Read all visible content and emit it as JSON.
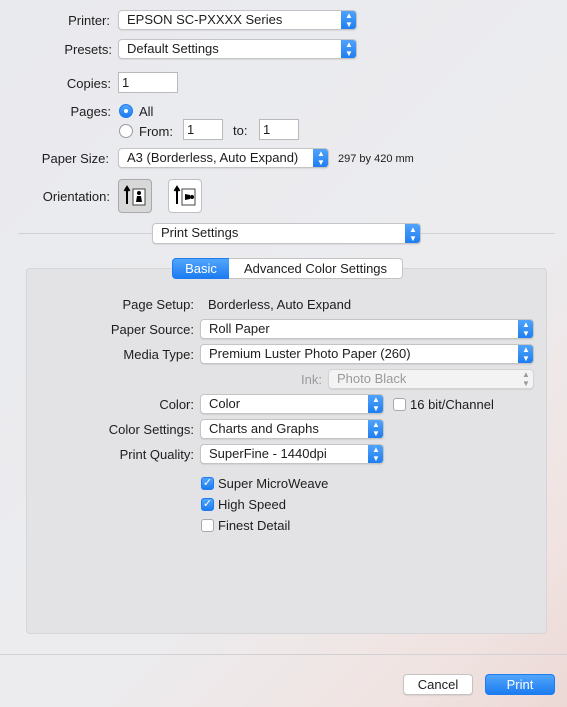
{
  "printer": {
    "label": "Printer:",
    "value": "EPSON SC-PXXXX Series"
  },
  "presets": {
    "label": "Presets:",
    "value": "Default Settings"
  },
  "copies": {
    "label": "Copies:",
    "value": "1"
  },
  "pages": {
    "label": "Pages:",
    "all_label": "All",
    "from_label": "From:",
    "from_value": "1",
    "to_label": "to:",
    "to_value": "1",
    "selected": "All"
  },
  "paper_size": {
    "label": "Paper Size:",
    "value": "A3 (Borderless, Auto Expand)",
    "dimensions": "297 by 420 mm"
  },
  "orientation": {
    "label": "Orientation:",
    "selected": "portrait",
    "options": [
      "portrait",
      "landscape"
    ]
  },
  "section_menu": {
    "value": "Print Settings"
  },
  "tabs": {
    "basic": "Basic",
    "advanced": "Advanced Color Settings",
    "selected": "Basic"
  },
  "settings": {
    "page_setup_label": "Page Setup:",
    "page_setup_value": "Borderless, Auto Expand",
    "paper_source_label": "Paper Source:",
    "paper_source_value": "Roll Paper",
    "media_type_label": "Media Type:",
    "media_type_value": "Premium Luster Photo Paper (260)",
    "ink_label": "Ink:",
    "ink_value": "Photo Black",
    "color_label": "Color:",
    "color_value": "Color",
    "bit16_label": "16 bit/Channel",
    "bit16_checked": false,
    "color_settings_label": "Color Settings:",
    "color_settings_value": "Charts and Graphs",
    "print_quality_label": "Print Quality:",
    "print_quality_value": "SuperFine - 1440dpi"
  },
  "options": {
    "super_microweave": {
      "label": "Super MicroWeave",
      "checked": true
    },
    "high_speed": {
      "label": "High Speed",
      "checked": true
    },
    "finest_detail": {
      "label": "Finest Detail",
      "checked": false
    }
  },
  "buttons": {
    "cancel": "Cancel",
    "print": "Print"
  },
  "colors": {
    "accent": "#1c7cf0",
    "panel": "#e3e3e5"
  }
}
